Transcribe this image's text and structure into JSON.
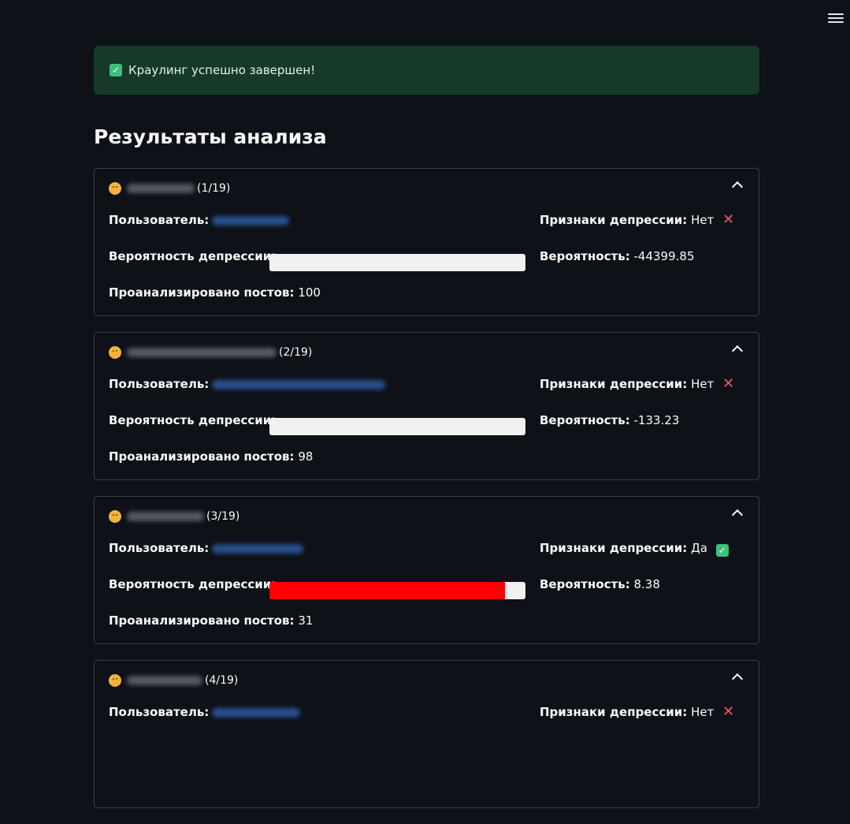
{
  "alert": {
    "text": "Краулинг успешно завершен!",
    "icon": "check-box-icon"
  },
  "title": "Результаты анализа",
  "labels": {
    "user": "Пользователь:",
    "signs": "Признаки депрессии:",
    "probability_bar": "Вероятность депрессии:",
    "probability": "Вероятность:",
    "posts": "Проанализировано постов:"
  },
  "colors": {
    "background": "#0e1117",
    "alert_bg": "#173928",
    "bar_fill": "#ff0000",
    "bar_track": "#f0f0f0",
    "link": "#2e5fa8"
  },
  "cards": [
    {
      "counter": "(1/19)",
      "signs": "Нет",
      "signs_icon": "x-icon",
      "probability": "-44399.85",
      "posts": "100",
      "bar_fraction": 0
    },
    {
      "counter": "(2/19)",
      "signs": "Нет",
      "signs_icon": "x-icon",
      "probability": "-133.23",
      "posts": "98",
      "bar_fraction": 0
    },
    {
      "counter": "(3/19)",
      "signs": "Да",
      "signs_icon": "check-icon",
      "probability": "8.38",
      "posts": "31",
      "bar_fraction": 0.92
    },
    {
      "counter": "(4/19)",
      "signs": "Нет",
      "signs_icon": "x-icon",
      "probability": "",
      "posts": "",
      "bar_fraction": 0
    }
  ]
}
